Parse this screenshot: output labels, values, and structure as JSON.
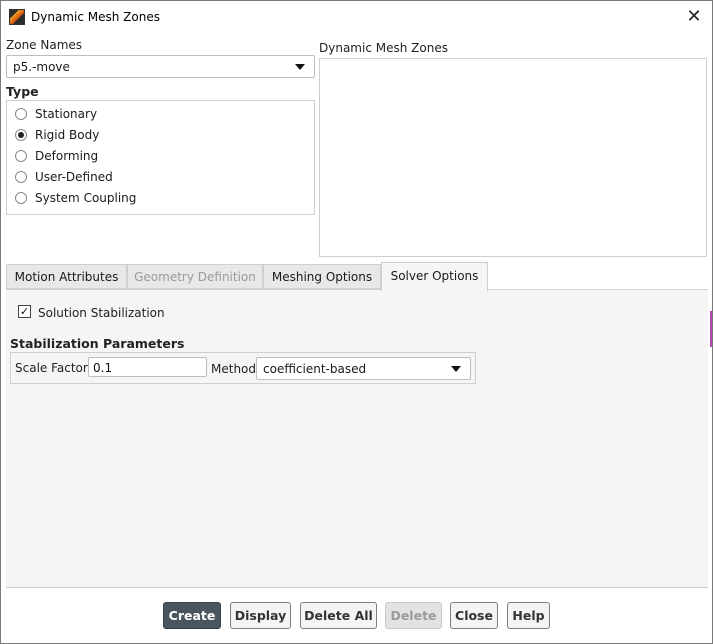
{
  "window": {
    "title": "Dynamic Mesh Zones",
    "close_glyph": "✕"
  },
  "zone_names": {
    "label": "Zone Names",
    "selected": "p5.-move"
  },
  "dynamic_mesh_zones": {
    "label": "Dynamic Mesh Zones"
  },
  "type": {
    "label": "Type",
    "options": [
      {
        "label": "Stationary",
        "checked": false
      },
      {
        "label": "Rigid Body",
        "checked": true
      },
      {
        "label": "Deforming",
        "checked": false
      },
      {
        "label": "User-Defined",
        "checked": false
      },
      {
        "label": "System Coupling",
        "checked": false
      }
    ]
  },
  "tabs": [
    {
      "label": "Motion Attributes",
      "state": "normal"
    },
    {
      "label": "Geometry Definition",
      "state": "disabled"
    },
    {
      "label": "Meshing Options",
      "state": "normal"
    },
    {
      "label": "Solver Options",
      "state": "active"
    }
  ],
  "solver_options": {
    "solution_stabilization": {
      "label": "Solution Stabilization",
      "checked": true,
      "check_glyph": "✓"
    },
    "stabilization_parameters": {
      "label": "Stabilization Parameters",
      "scale_factor_label": "Scale Factor",
      "scale_factor_value": "0.1",
      "method_label": "Method",
      "method_value": "coefficient-based"
    }
  },
  "buttons": {
    "create": "Create",
    "display": "Display",
    "delete_all": "Delete All",
    "delete": "Delete",
    "close": "Close",
    "help": "Help"
  },
  "colors": {
    "primary_button": "#4a5560",
    "panel_bg": "#f5f5f5"
  }
}
